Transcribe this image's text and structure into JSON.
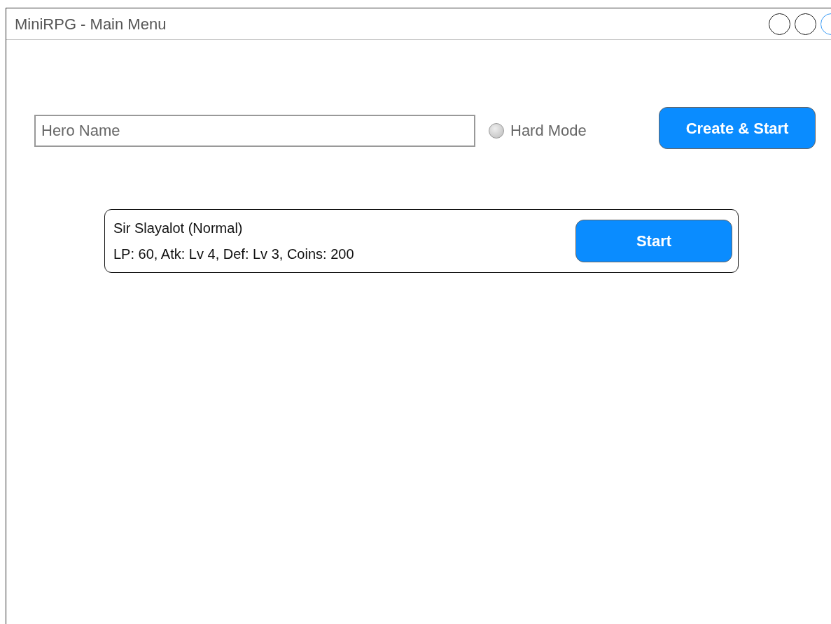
{
  "window": {
    "title": "MiniRPG - Main Menu",
    "controls": [
      {
        "kind": "plain"
      },
      {
        "kind": "plain"
      },
      {
        "kind": "accent"
      }
    ]
  },
  "new_hero": {
    "name_field": {
      "placeholder": "Hero Name"
    },
    "hard_mode": {
      "label": "Hard Mode",
      "checked": false
    },
    "button": "Create & Start"
  },
  "saved_heroes": [
    {
      "title": "Sir Slayalot (Normal)",
      "stats": "LP: 60, Atk: Lv 4, Def: Lv 3, Coins: 200",
      "button": "Start"
    }
  ]
}
